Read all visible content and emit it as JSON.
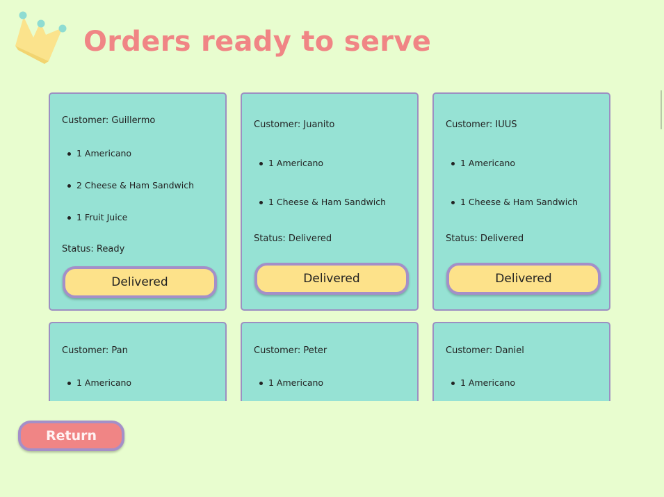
{
  "header": {
    "title": "Orders ready to serve",
    "logo_icon": "crown-icon"
  },
  "colors": {
    "background": "#e8fdcf",
    "title": "#f08585",
    "card": "#96e2d4",
    "card_border": "#9c8fc2",
    "deliver_button": "#fde28a",
    "return_button": "#f08585"
  },
  "orders": [
    {
      "customer": "Customer: Guillermo",
      "items": [
        "1 Americano",
        "2 Cheese & Ham Sandwich",
        "1 Fruit Juice"
      ],
      "status": "Status: Ready",
      "button": "Delivered"
    },
    {
      "customer": "Customer: Juanito",
      "items": [
        "1 Americano",
        "1 Cheese & Ham Sandwich"
      ],
      "status": "Status: Delivered",
      "button": "Delivered"
    },
    {
      "customer": "Customer: IUUS",
      "items": [
        "1 Americano",
        "1 Cheese & Ham Sandwich"
      ],
      "status": "Status: Delivered",
      "button": "Delivered"
    },
    {
      "customer": "Customer: Pan",
      "items": [
        "1 Americano"
      ]
    },
    {
      "customer": "Customer: Peter",
      "items": [
        "1 Americano"
      ]
    },
    {
      "customer": "Customer: Daniel",
      "items": [
        "1 Americano"
      ]
    }
  ],
  "footer": {
    "return_label": "Return"
  }
}
